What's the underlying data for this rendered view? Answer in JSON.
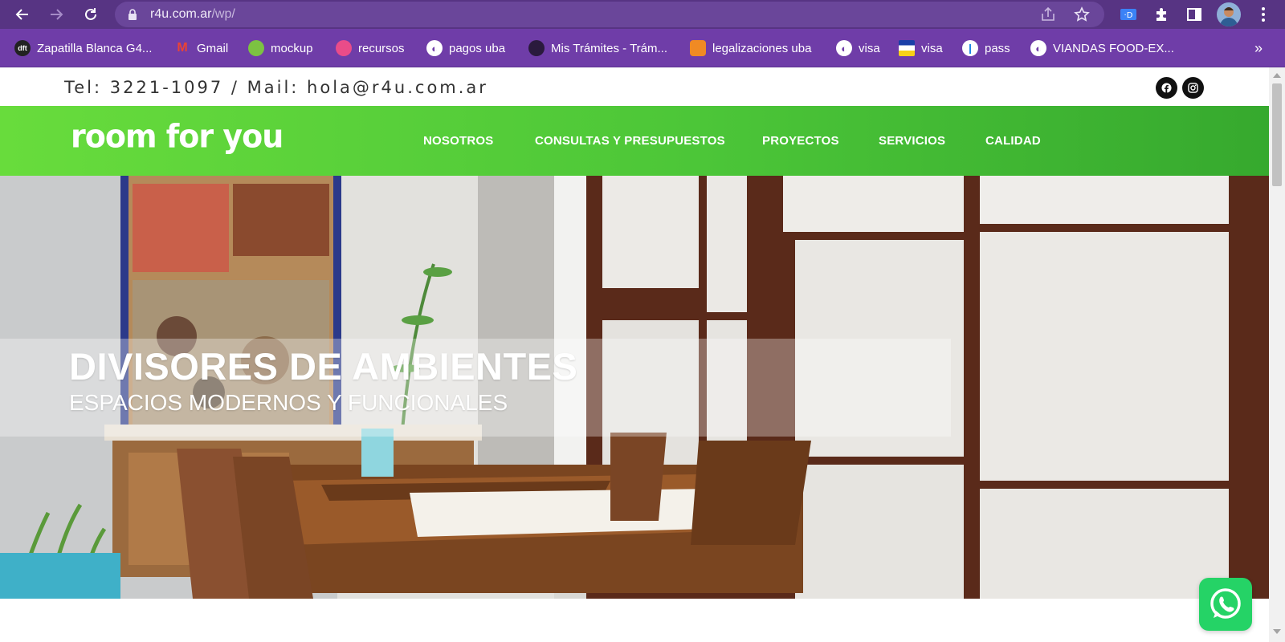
{
  "browser": {
    "url_host": "r4u.com.ar",
    "url_path": "/wp/",
    "bookmarks": [
      {
        "label": "Zapatilla Blanca G4...",
        "icon": "dft-icon",
        "color": "#222222",
        "glyph": "dft"
      },
      {
        "label": "Gmail",
        "icon": "gmail-icon",
        "color": "#ea4335",
        "glyph": "M"
      },
      {
        "label": "mockup",
        "icon": "mockup-icon",
        "color": "#7cc242",
        "glyph": "◉"
      },
      {
        "label": "recursos",
        "icon": "dribbble-icon",
        "color": "#ea4c89",
        "glyph": "◍"
      },
      {
        "label": "pagos uba",
        "icon": "globe-icon",
        "color": "#ffffff",
        "glyph": "◐"
      },
      {
        "label": "Mis Trámites - Trám...",
        "icon": "tramites-icon",
        "color": "#2a1a3d",
        "glyph": "◈"
      },
      {
        "label": "legalizaciones uba",
        "icon": "legalizaciones-icon",
        "color": "#f08a24",
        "glyph": "◎"
      },
      {
        "label": "visa",
        "icon": "globe-icon",
        "color": "#ffffff",
        "glyph": "◐"
      },
      {
        "label": "visa",
        "icon": "flag-icon",
        "color": "#f7d117",
        "glyph": ""
      },
      {
        "label": "pass",
        "icon": "pass-icon",
        "color": "#1e88e5",
        "glyph": "❙"
      },
      {
        "label": "VIANDAS FOOD-EX...",
        "icon": "globe-icon",
        "color": "#ffffff",
        "glyph": "◐"
      }
    ],
    "more": "»"
  },
  "site": {
    "contact": "Tel:  3221-1097  /  Mail:  hola@r4u.com.ar",
    "logo": "room for you",
    "nav": [
      "NOSOTROS",
      "CONSULTAS Y PRESUPUESTOS",
      "PROYECTOS",
      "SERVICIOS",
      "CALIDAD"
    ],
    "hero_title": "DIVISORES DE AMBIENTES",
    "hero_subtitle": "ESPACIOS MODERNOS Y FUNCIONALES"
  },
  "colors": {
    "browser_toolbar": "#573483",
    "bookmarks_bar": "#6f3da8",
    "nav_green": "#4cc638",
    "whatsapp_green": "#25d366"
  }
}
